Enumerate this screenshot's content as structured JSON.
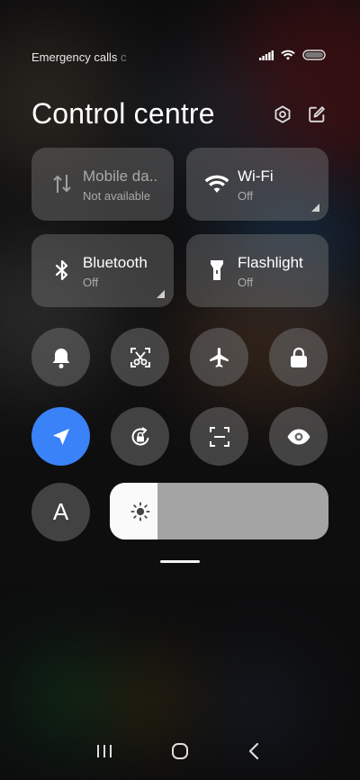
{
  "status_bar": {
    "carrier_text": "Emergency calls",
    "carrier_fade": " c",
    "icons": [
      "signal-icon",
      "wifi-icon",
      "battery-icon"
    ]
  },
  "header": {
    "title": "Control centre",
    "settings_icon": "settings-icon",
    "edit_icon": "edit-icon"
  },
  "tiles": [
    {
      "label": "Mobile da..",
      "status": "Not available",
      "icon": "mobile-data-icon"
    },
    {
      "label": "Wi-Fi",
      "status": "Off",
      "icon": "wifi-icon"
    },
    {
      "label": "Bluetooth",
      "status": "Off",
      "icon": "bluetooth-icon"
    },
    {
      "label": "Flashlight",
      "status": "Off",
      "icon": "flashlight-icon"
    }
  ],
  "toggles_row1": [
    {
      "icon": "bell-icon"
    },
    {
      "icon": "screenshot-icon"
    },
    {
      "icon": "airplane-icon"
    },
    {
      "icon": "lock-icon"
    }
  ],
  "toggles_row2": [
    {
      "icon": "location-icon",
      "active": true
    },
    {
      "icon": "rotation-lock-icon"
    },
    {
      "icon": "scan-icon"
    },
    {
      "icon": "eye-icon"
    }
  ],
  "font_button": {
    "label": "A"
  },
  "brightness": {
    "level": 0.22
  },
  "colors": {
    "accent": "#3a82f7",
    "tile_bg": "#7d7d7d"
  }
}
